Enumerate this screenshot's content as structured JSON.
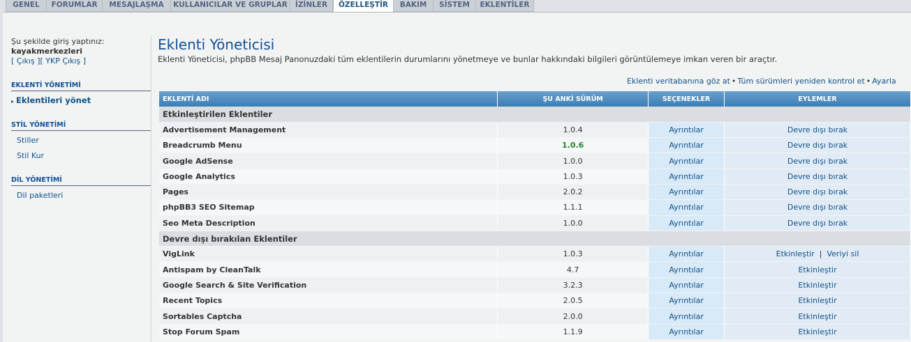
{
  "tabs": [
    "GENEL",
    "FORUMLAR",
    "MESAJLAŞMA",
    "KULLANICILAR VE GRUPLAR",
    "İZİNLER",
    "ÖZELLEŞTİR",
    "BAKIM",
    "SİSTEM",
    "EKLENTİLER"
  ],
  "active_tab": "ÖZELLEŞTİR",
  "sidebar": {
    "logged_in_label": "Şu şekilde giriş yaptınız:",
    "username": "kayakmerkezleri",
    "logout_links": "[ Çıkış ][ YKP Çıkış ]",
    "sections": [
      {
        "title": "EKLENTİ YÖNETİMİ",
        "items": [
          "Eklentileri yönet"
        ]
      },
      {
        "title": "STİL YÖNETİMİ",
        "items": [
          "Stiller",
          "Stil Kur"
        ]
      },
      {
        "title": "DİL YÖNETİMİ",
        "items": [
          "Dil paketleri"
        ]
      }
    ]
  },
  "main": {
    "title": "Eklenti Yöneticisi",
    "description": "Eklenti Yöneticisi, phpBB Mesaj Panonuzdaki tüm eklentilerin durumlarını yönetmeye ve bunlar hakkındaki bilgileri görüntülemeye imkan veren bir araçtır.",
    "top_links": [
      "Eklenti veritabanına göz at",
      "Tüm sürümleri yeniden kontrol et",
      "Ayarla"
    ],
    "table": {
      "headers": [
        "EKLENTİ ADI",
        "ŞU ANKİ SÜRÜM",
        "SEÇENEKLER",
        "EYLEMLER"
      ],
      "enabled_group": "Etkinleştirilen Eklentiler",
      "enabled": [
        {
          "name": "Advertisement Management",
          "version": "1.0.4",
          "option": "Ayrıntılar",
          "action": "Devre dışı bırak"
        },
        {
          "name": "Breadcrumb Menu",
          "version": "1.0.6",
          "option": "Ayrıntılar",
          "action": "Devre dışı bırak"
        },
        {
          "name": "Google AdSense",
          "version": "1.0.0",
          "option": "Ayrıntılar",
          "action": "Devre dışı bırak"
        },
        {
          "name": "Google Analytics",
          "version": "1.0.3",
          "option": "Ayrıntılar",
          "action": "Devre dışı bırak"
        },
        {
          "name": "Pages",
          "version": "2.0.2",
          "option": "Ayrıntılar",
          "action": "Devre dışı bırak"
        },
        {
          "name": "phpBB3 SEO Sitemap",
          "version": "1.1.1",
          "option": "Ayrıntılar",
          "action": "Devre dışı bırak"
        },
        {
          "name": "Seo Meta Description",
          "version": "1.0.0",
          "option": "Ayrıntılar",
          "action": "Devre dışı bırak"
        }
      ],
      "disabled_group": "Devre dışı bırakılan Eklentiler",
      "disabled": [
        {
          "name": "VigLink",
          "version": "1.0.3",
          "option": "Ayrıntılar",
          "action": "Etkinleştir",
          "action2": "Veriyi sil"
        },
        {
          "name": "Antispam by CleanTalk",
          "version": "4.7",
          "option": "Ayrıntılar",
          "action": "Etkinleştir"
        },
        {
          "name": "Google Search & Site Verification",
          "version": "3.2.3",
          "option": "Ayrıntılar",
          "action": "Etkinleştir"
        },
        {
          "name": "Recent Topics",
          "version": "2.0.5",
          "option": "Ayrıntılar",
          "action": "Etkinleştir"
        },
        {
          "name": "Sortables Captcha",
          "version": "2.0.0",
          "option": "Ayrıntılar",
          "action": "Etkinleştir"
        },
        {
          "name": "Stop Forum Spam",
          "version": "1.1.9",
          "option": "Ayrıntılar",
          "action": "Etkinleştir"
        }
      ]
    }
  },
  "colors": {
    "accent": "#115098",
    "header_bar": "#4a8bc0",
    "highlight_version": "#228822"
  }
}
